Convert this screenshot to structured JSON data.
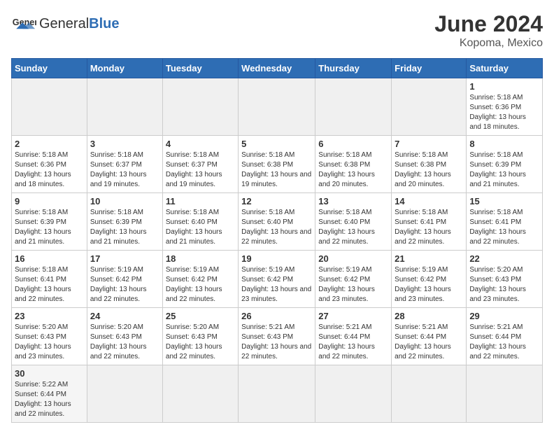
{
  "header": {
    "logo_general": "General",
    "logo_blue": "Blue",
    "month_year": "June 2024",
    "location": "Kopoma, Mexico"
  },
  "weekdays": [
    "Sunday",
    "Monday",
    "Tuesday",
    "Wednesday",
    "Thursday",
    "Friday",
    "Saturday"
  ],
  "weeks": [
    [
      {
        "day": "",
        "info": ""
      },
      {
        "day": "",
        "info": ""
      },
      {
        "day": "",
        "info": ""
      },
      {
        "day": "",
        "info": ""
      },
      {
        "day": "",
        "info": ""
      },
      {
        "day": "",
        "info": ""
      },
      {
        "day": "1",
        "info": "Sunrise: 5:18 AM\nSunset: 6:36 PM\nDaylight: 13 hours and 18 minutes."
      }
    ],
    [
      {
        "day": "2",
        "info": "Sunrise: 5:18 AM\nSunset: 6:36 PM\nDaylight: 13 hours and 18 minutes."
      },
      {
        "day": "3",
        "info": "Sunrise: 5:18 AM\nSunset: 6:37 PM\nDaylight: 13 hours and 19 minutes."
      },
      {
        "day": "4",
        "info": "Sunrise: 5:18 AM\nSunset: 6:37 PM\nDaylight: 13 hours and 19 minutes."
      },
      {
        "day": "5",
        "info": "Sunrise: 5:18 AM\nSunset: 6:38 PM\nDaylight: 13 hours and 19 minutes."
      },
      {
        "day": "6",
        "info": "Sunrise: 5:18 AM\nSunset: 6:38 PM\nDaylight: 13 hours and 20 minutes."
      },
      {
        "day": "7",
        "info": "Sunrise: 5:18 AM\nSunset: 6:38 PM\nDaylight: 13 hours and 20 minutes."
      },
      {
        "day": "8",
        "info": "Sunrise: 5:18 AM\nSunset: 6:39 PM\nDaylight: 13 hours and 21 minutes."
      }
    ],
    [
      {
        "day": "9",
        "info": "Sunrise: 5:18 AM\nSunset: 6:39 PM\nDaylight: 13 hours and 21 minutes."
      },
      {
        "day": "10",
        "info": "Sunrise: 5:18 AM\nSunset: 6:39 PM\nDaylight: 13 hours and 21 minutes."
      },
      {
        "day": "11",
        "info": "Sunrise: 5:18 AM\nSunset: 6:40 PM\nDaylight: 13 hours and 21 minutes."
      },
      {
        "day": "12",
        "info": "Sunrise: 5:18 AM\nSunset: 6:40 PM\nDaylight: 13 hours and 22 minutes."
      },
      {
        "day": "13",
        "info": "Sunrise: 5:18 AM\nSunset: 6:40 PM\nDaylight: 13 hours and 22 minutes."
      },
      {
        "day": "14",
        "info": "Sunrise: 5:18 AM\nSunset: 6:41 PM\nDaylight: 13 hours and 22 minutes."
      },
      {
        "day": "15",
        "info": "Sunrise: 5:18 AM\nSunset: 6:41 PM\nDaylight: 13 hours and 22 minutes."
      }
    ],
    [
      {
        "day": "16",
        "info": "Sunrise: 5:18 AM\nSunset: 6:41 PM\nDaylight: 13 hours and 22 minutes."
      },
      {
        "day": "17",
        "info": "Sunrise: 5:19 AM\nSunset: 6:42 PM\nDaylight: 13 hours and 22 minutes."
      },
      {
        "day": "18",
        "info": "Sunrise: 5:19 AM\nSunset: 6:42 PM\nDaylight: 13 hours and 22 minutes."
      },
      {
        "day": "19",
        "info": "Sunrise: 5:19 AM\nSunset: 6:42 PM\nDaylight: 13 hours and 23 minutes."
      },
      {
        "day": "20",
        "info": "Sunrise: 5:19 AM\nSunset: 6:42 PM\nDaylight: 13 hours and 23 minutes."
      },
      {
        "day": "21",
        "info": "Sunrise: 5:19 AM\nSunset: 6:42 PM\nDaylight: 13 hours and 23 minutes."
      },
      {
        "day": "22",
        "info": "Sunrise: 5:20 AM\nSunset: 6:43 PM\nDaylight: 13 hours and 23 minutes."
      }
    ],
    [
      {
        "day": "23",
        "info": "Sunrise: 5:20 AM\nSunset: 6:43 PM\nDaylight: 13 hours and 23 minutes."
      },
      {
        "day": "24",
        "info": "Sunrise: 5:20 AM\nSunset: 6:43 PM\nDaylight: 13 hours and 22 minutes."
      },
      {
        "day": "25",
        "info": "Sunrise: 5:20 AM\nSunset: 6:43 PM\nDaylight: 13 hours and 22 minutes."
      },
      {
        "day": "26",
        "info": "Sunrise: 5:21 AM\nSunset: 6:43 PM\nDaylight: 13 hours and 22 minutes."
      },
      {
        "day": "27",
        "info": "Sunrise: 5:21 AM\nSunset: 6:44 PM\nDaylight: 13 hours and 22 minutes."
      },
      {
        "day": "28",
        "info": "Sunrise: 5:21 AM\nSunset: 6:44 PM\nDaylight: 13 hours and 22 minutes."
      },
      {
        "day": "29",
        "info": "Sunrise: 5:21 AM\nSunset: 6:44 PM\nDaylight: 13 hours and 22 minutes."
      }
    ],
    [
      {
        "day": "30",
        "info": "Sunrise: 5:22 AM\nSunset: 6:44 PM\nDaylight: 13 hours and 22 minutes."
      },
      {
        "day": "",
        "info": ""
      },
      {
        "day": "",
        "info": ""
      },
      {
        "day": "",
        "info": ""
      },
      {
        "day": "",
        "info": ""
      },
      {
        "day": "",
        "info": ""
      },
      {
        "day": "",
        "info": ""
      }
    ]
  ]
}
